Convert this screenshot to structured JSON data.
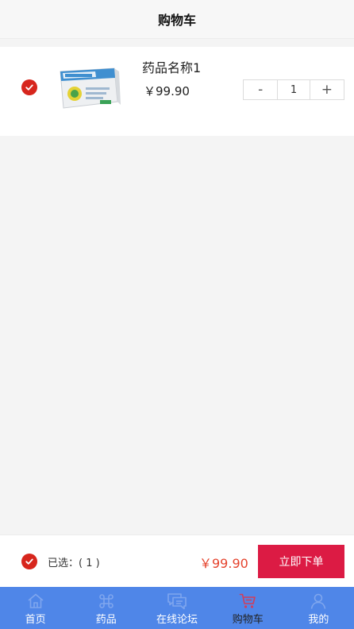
{
  "header": {
    "title": "购物车"
  },
  "cart": {
    "items": [
      {
        "name": "药品名称1",
        "price": "￥99.90",
        "quantity": "1",
        "checked": true
      }
    ]
  },
  "stepper": {
    "minus": "-",
    "plus": "+"
  },
  "checkout": {
    "selected_text": "已选：( 1 )",
    "total": "￥99.90",
    "order_label": "立即下单"
  },
  "tabbar": {
    "items": [
      {
        "label": "首页",
        "icon": "home-icon"
      },
      {
        "label": "药品",
        "icon": "medicine-icon"
      },
      {
        "label": "在线论坛",
        "icon": "forum-icon"
      },
      {
        "label": "购物车",
        "icon": "cart-icon",
        "active": true
      },
      {
        "label": "我的",
        "icon": "user-icon"
      }
    ]
  },
  "colors": {
    "accent_red": "#d7261d",
    "order_button": "#dc1b44",
    "price_red": "#e5432d",
    "tabbar_bg": "#4f86e8",
    "tab_icon_inactive": "#7fa6ee",
    "tab_icon_active": "#d23d5a"
  }
}
